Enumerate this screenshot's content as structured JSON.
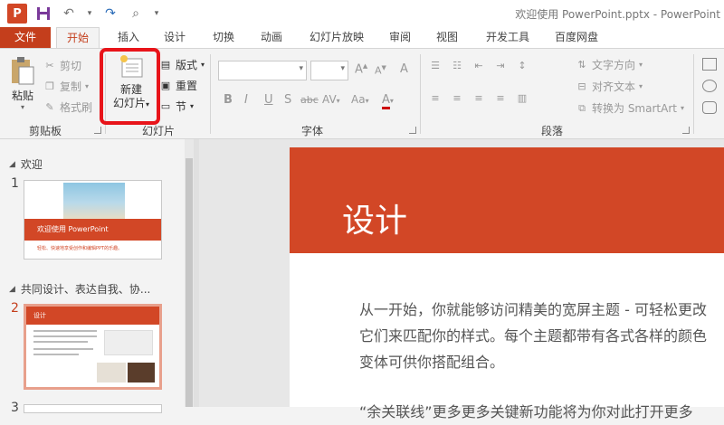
{
  "app": {
    "window_title": "欢迎使用 PowerPoint.pptx - PowerPoint",
    "logo_letter": "P"
  },
  "quick_access": {
    "save_icon": "save-icon",
    "undo_icon": "undo-icon",
    "redo_icon": "redo-icon",
    "present_icon": "start-from-beginning-icon"
  },
  "tabs": [
    "文件",
    "开始",
    "插入",
    "设计",
    "切换",
    "动画",
    "幻灯片放映",
    "审阅",
    "视图",
    "开发工具",
    "百度网盘"
  ],
  "active_tab": "开始",
  "ribbon": {
    "clipboard": {
      "paste": "粘贴",
      "cut": "剪切",
      "copy": "复制",
      "format_painter": "格式刷",
      "group_label": "剪贴板"
    },
    "slides": {
      "new_slide_line1": "新建",
      "new_slide_line2": "幻灯片",
      "layout": "版式",
      "reset": "重置",
      "section": "节",
      "group_label": "幻灯片"
    },
    "font": {
      "font_name_value": "",
      "font_size_value": "",
      "bold": "B",
      "italic": "I",
      "underline": "U",
      "shadow": "S",
      "strikethrough": "abc",
      "spacing": "AV",
      "change_case": "Aa",
      "font_color": "A",
      "grow": "A",
      "shrink": "A",
      "clear_format": "A",
      "group_label": "字体"
    },
    "paragraph": {
      "text_direction": "文字方向",
      "align_text": "对齐文本",
      "convert_smartart": "转换为 SmartArt",
      "group_label": "段落"
    }
  },
  "thumbnails": {
    "section1": "欢迎",
    "slide1_num": "1",
    "slide1_title": "欢迎使用 PowerPoint",
    "slide1_sub": "轻松、快速地享受创作和编辑PPT的乐趣。",
    "section2": "共同设计、表达自我、协...",
    "slide2_num": "2",
    "slide2_title": "设计",
    "slide3_num": "3"
  },
  "slide": {
    "title": "设计",
    "body": "从一开始，你就能够访问精美的宽屏主题 - 可轻松更改它们来匹配你的样式。每个主题都带有各式各样的颜色变体可供你搭配组合。",
    "body2": "“余关联线”更多更多关键新功能将为你对此打开更多"
  },
  "colors": {
    "accent": "#d24726",
    "file_tab": "#c43e1c",
    "highlight": "#e8141a"
  }
}
